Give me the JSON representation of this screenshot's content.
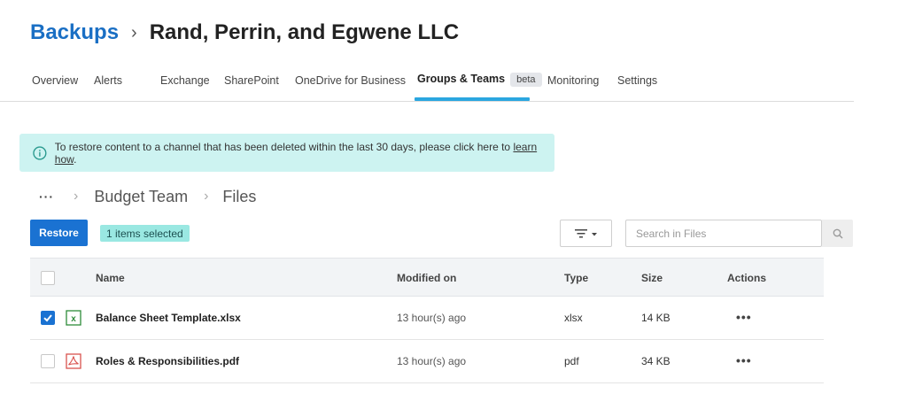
{
  "header": {
    "app_link": "Backups",
    "separator": "›",
    "org_name": "Rand, Perrin, and Egwene LLC"
  },
  "tabs": [
    {
      "label": "Overview"
    },
    {
      "label": "Alerts"
    },
    {
      "label": "Exchange"
    },
    {
      "label": "SharePoint"
    },
    {
      "label": "OneDrive for Business"
    },
    {
      "label": "Groups & Teams",
      "active": true,
      "badge": "beta"
    },
    {
      "label": "Monitoring"
    },
    {
      "label": "Settings"
    }
  ],
  "banner": {
    "text": "To restore content to a channel that has been deleted within the last 30 days, please click here to ",
    "link": "learn how",
    "suffix": "."
  },
  "breadcrumb": {
    "more": "···",
    "items": [
      "Budget Team",
      "Files"
    ]
  },
  "toolbar": {
    "restore_label": "Restore",
    "selected_label": "1 items selected",
    "search_placeholder": "Search in Files"
  },
  "table": {
    "columns": [
      "Name",
      "Modified on",
      "Type",
      "Size",
      "Actions"
    ],
    "rows": [
      {
        "name": "Balance Sheet Template.xlsx",
        "modified": "13 hour(s) ago",
        "type": "xlsx",
        "size": "14 KB",
        "actions": "•••",
        "checked": true,
        "icon": "excel-file-icon"
      },
      {
        "name": "Roles & Responsibilities.pdf",
        "modified": "13 hour(s) ago",
        "type": "pdf",
        "size": "34 KB",
        "actions": "•••",
        "checked": false,
        "icon": "pdf-file-icon"
      }
    ]
  },
  "colors": {
    "brand_blue": "#1a72d2",
    "title_blue": "#1a6fc4",
    "tab_underline": "#2aa6e0",
    "banner_bg": "#cdf3f1",
    "badge_bg": "#9ae8e2",
    "excel_green": "#2e8b3a",
    "pdf_red": "#d9534f"
  }
}
